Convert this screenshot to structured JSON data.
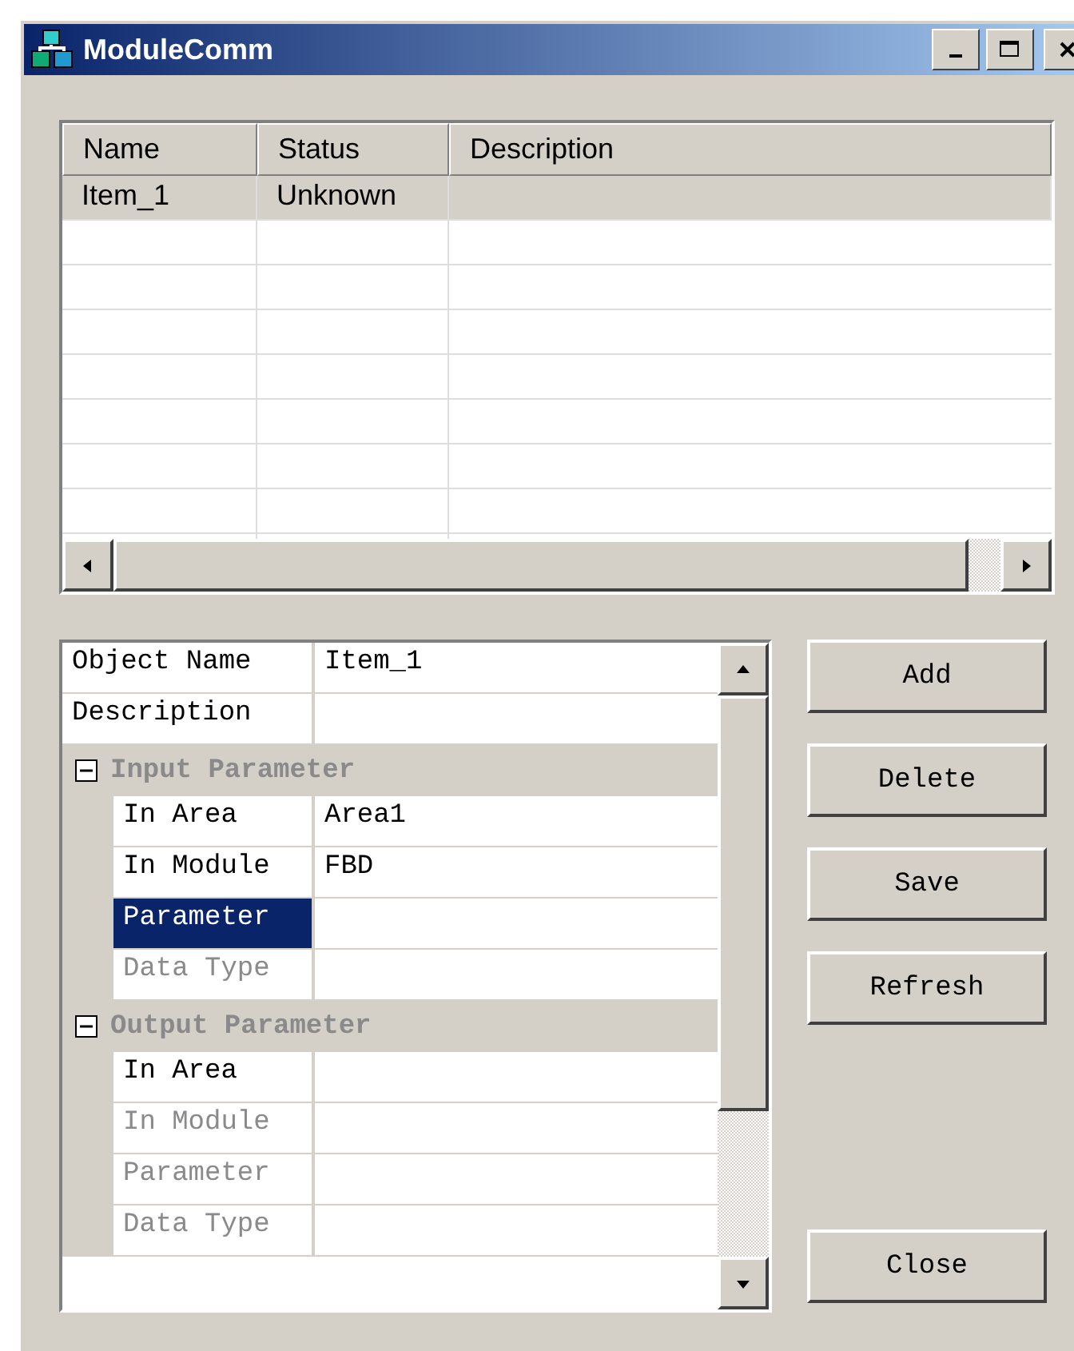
{
  "window": {
    "title": "ModuleComm"
  },
  "list": {
    "columns": [
      "Name",
      "Status",
      "Description"
    ],
    "rows": [
      {
        "cells": [
          "Item_1",
          "Unknown",
          null
        ],
        "selected": true
      }
    ]
  },
  "properties": [
    {
      "kind": "row",
      "label": "Object Name",
      "value": "Item_1",
      "selected": false,
      "disabled": false
    },
    {
      "kind": "row",
      "label": "Description",
      "selected": false,
      "disabled": false
    },
    {
      "kind": "category",
      "label": "Input Parameter",
      "expanded": true,
      "children": [
        {
          "kind": "row",
          "label": "In Area",
          "value": "Area1",
          "selected": false,
          "disabled": false
        },
        {
          "kind": "row",
          "label": "In Module",
          "value": "FBD",
          "selected": false,
          "disabled": false
        },
        {
          "kind": "row",
          "label": "Parameter",
          "selected": true,
          "disabled": false
        },
        {
          "kind": "row",
          "label": "Data Type",
          "selected": false,
          "disabled": true
        }
      ]
    },
    {
      "kind": "category",
      "label": "Output Parameter",
      "expanded": true,
      "children": [
        {
          "kind": "row",
          "label": "In Area",
          "selected": false,
          "disabled": false
        },
        {
          "kind": "row",
          "label": "In Module",
          "selected": false,
          "disabled": true
        },
        {
          "kind": "row",
          "label": "Parameter",
          "selected": false,
          "disabled": true
        },
        {
          "kind": "row",
          "label": "Data Type",
          "selected": false,
          "disabled": true
        }
      ]
    }
  ],
  "buttons": [
    "Add",
    "Delete",
    "Save",
    "Refresh"
  ],
  "close_button": "Close"
}
